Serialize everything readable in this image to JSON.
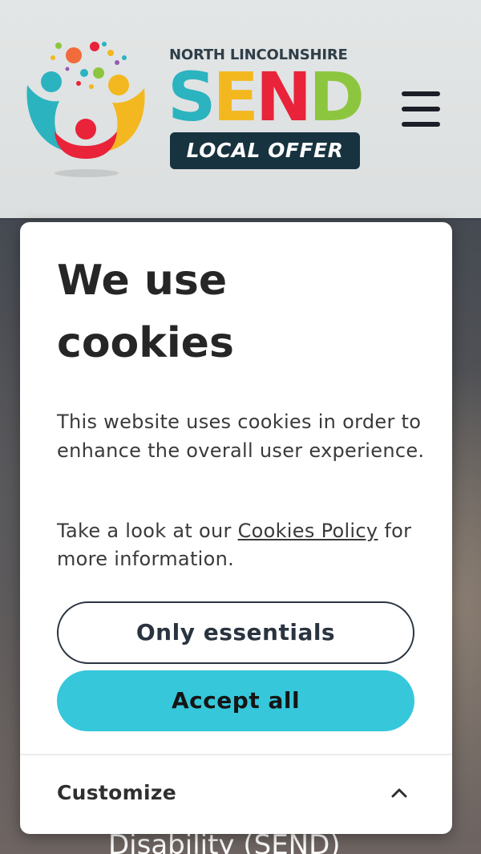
{
  "header": {
    "logo": {
      "supertitle": "NORTH LINCOLNSHIRE",
      "wordmark": [
        "S",
        "E",
        "N",
        "D"
      ],
      "wordmark_colors": [
        "#2bb3c0",
        "#f3b81f",
        "#e8233a",
        "#8cc63f"
      ],
      "subtitle": "LOCAL OFFER"
    },
    "menu_icon": "hamburger-menu-icon"
  },
  "hero": {
    "partial_text": "Disability (SEND)"
  },
  "cookie_banner": {
    "title": "We use cookies",
    "body": "This website uses cookies in order to enhance the overall user experience.",
    "more_prefix": "Take a look at our ",
    "more_link": "Cookies Policy",
    "more_suffix": " for more information.",
    "buttons": {
      "essentials": "Only essentials",
      "accept": "Accept all"
    },
    "customize": {
      "label": "Customize",
      "icon": "chevron-up-icon"
    }
  },
  "colors": {
    "accent": "#36c7db",
    "logo_navy": "#17333f",
    "text_dark": "#262626"
  }
}
